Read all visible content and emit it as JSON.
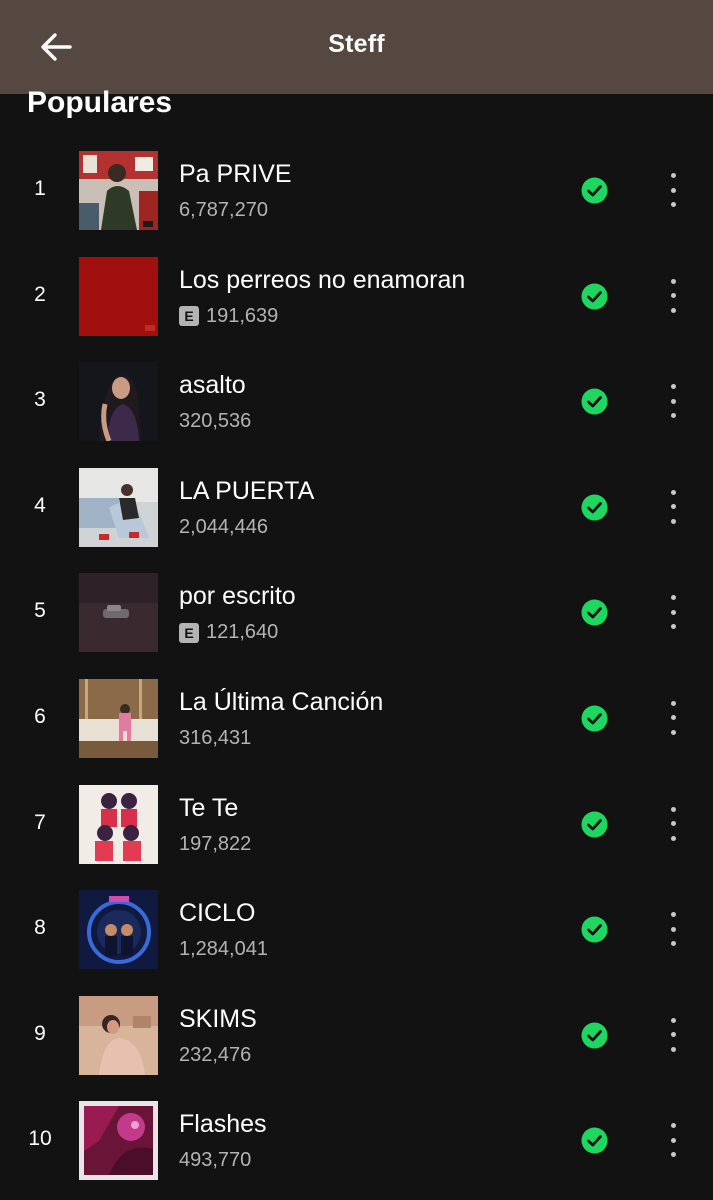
{
  "header": {
    "title": "Steff",
    "back_icon": "arrow-left-icon"
  },
  "section": {
    "title": "Populares"
  },
  "colors": {
    "header_bg": "#544841",
    "page_bg": "#121212",
    "accent_green": "#1ed760",
    "secondary_text": "#b3b3b3"
  },
  "tracks": [
    {
      "rank": "1",
      "title": "Pa PRIVE",
      "plays": "6,787,270",
      "explicit": false,
      "explicit_label": "",
      "downloaded_icon": "check-circle-icon",
      "menu_icon": "more-vertical-icon"
    },
    {
      "rank": "2",
      "title": "Los perreos no enamoran",
      "plays": "191,639",
      "explicit": true,
      "explicit_label": "E",
      "downloaded_icon": "check-circle-icon",
      "menu_icon": "more-vertical-icon"
    },
    {
      "rank": "3",
      "title": "asalto",
      "plays": "320,536",
      "explicit": false,
      "explicit_label": "",
      "downloaded_icon": "check-circle-icon",
      "menu_icon": "more-vertical-icon"
    },
    {
      "rank": "4",
      "title": "LA PUERTA",
      "plays": "2,044,446",
      "explicit": false,
      "explicit_label": "",
      "downloaded_icon": "check-circle-icon",
      "menu_icon": "more-vertical-icon"
    },
    {
      "rank": "5",
      "title": "por escrito",
      "plays": "121,640",
      "explicit": true,
      "explicit_label": "E",
      "downloaded_icon": "check-circle-icon",
      "menu_icon": "more-vertical-icon"
    },
    {
      "rank": "6",
      "title": "La Última Canción",
      "plays": "316,431",
      "explicit": false,
      "explicit_label": "",
      "downloaded_icon": "check-circle-icon",
      "menu_icon": "more-vertical-icon"
    },
    {
      "rank": "7",
      "title": "Te Te",
      "plays": "197,822",
      "explicit": false,
      "explicit_label": "",
      "downloaded_icon": "check-circle-icon",
      "menu_icon": "more-vertical-icon"
    },
    {
      "rank": "8",
      "title": "CICLO",
      "plays": "1,284,041",
      "explicit": false,
      "explicit_label": "",
      "downloaded_icon": "check-circle-icon",
      "menu_icon": "more-vertical-icon"
    },
    {
      "rank": "9",
      "title": "SKIMS",
      "plays": "232,476",
      "explicit": false,
      "explicit_label": "",
      "downloaded_icon": "check-circle-icon",
      "menu_icon": "more-vertical-icon"
    },
    {
      "rank": "10",
      "title": "Flashes",
      "plays": "493,770",
      "explicit": false,
      "explicit_label": "",
      "downloaded_icon": "check-circle-icon",
      "menu_icon": "more-vertical-icon"
    }
  ]
}
